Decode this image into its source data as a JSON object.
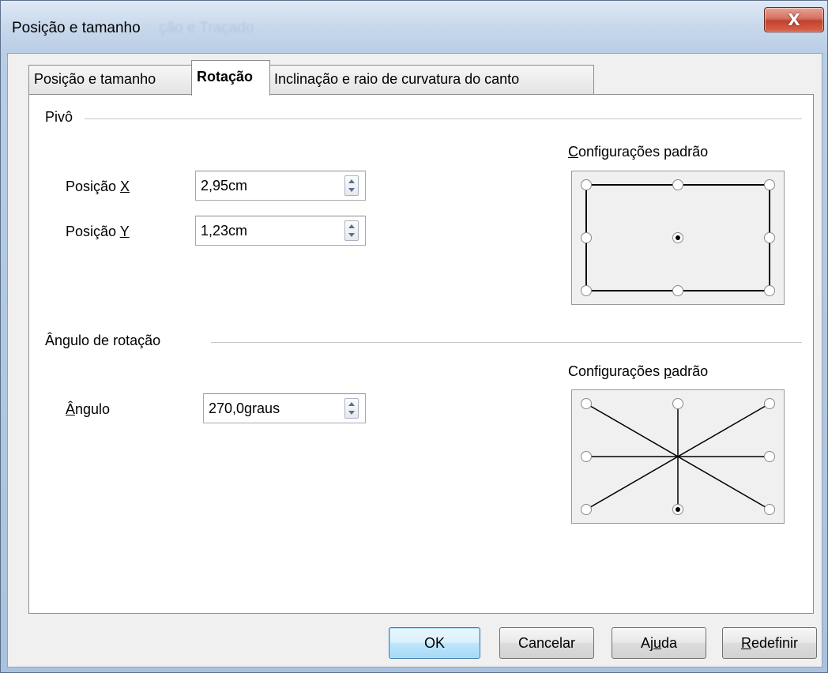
{
  "window": {
    "title": "Posição e tamanho",
    "title_ghost": "ção e Traçado"
  },
  "close_glyph": "X",
  "tabs": [
    {
      "label": "Posição e tamanho",
      "active": false
    },
    {
      "label": "Rotação",
      "active": true
    },
    {
      "label": "Inclinação e raio de curvatura do canto",
      "active": false
    }
  ],
  "pivot": {
    "group_label": "Pivô",
    "pos_x_label_pre": "Posição ",
    "pos_x_label_key": "X",
    "pos_x_value": "2,95cm",
    "pos_y_label_pre": "Posição ",
    "pos_y_label_key": "Y",
    "pos_y_value": "1,23cm",
    "defaults_key": "C",
    "defaults_rest": "onfigurações padrão"
  },
  "rotation": {
    "group_label": "Ângulo de rotação",
    "angle_label_key": "Â",
    "angle_label_rest": "ngulo",
    "angle_value": "270,0graus",
    "defaults_pre": "Configurações ",
    "defaults_key": "p",
    "defaults_rest": "adrão"
  },
  "buttons": {
    "ok": "OK",
    "cancel": "Cancelar",
    "help_pre": "Aj",
    "help_key": "u",
    "help_post": "da",
    "reset_key": "R",
    "reset_rest": "edefinir"
  },
  "colors": {
    "close_red": "#c2412c",
    "default_button_border": "#3c7fb1"
  }
}
